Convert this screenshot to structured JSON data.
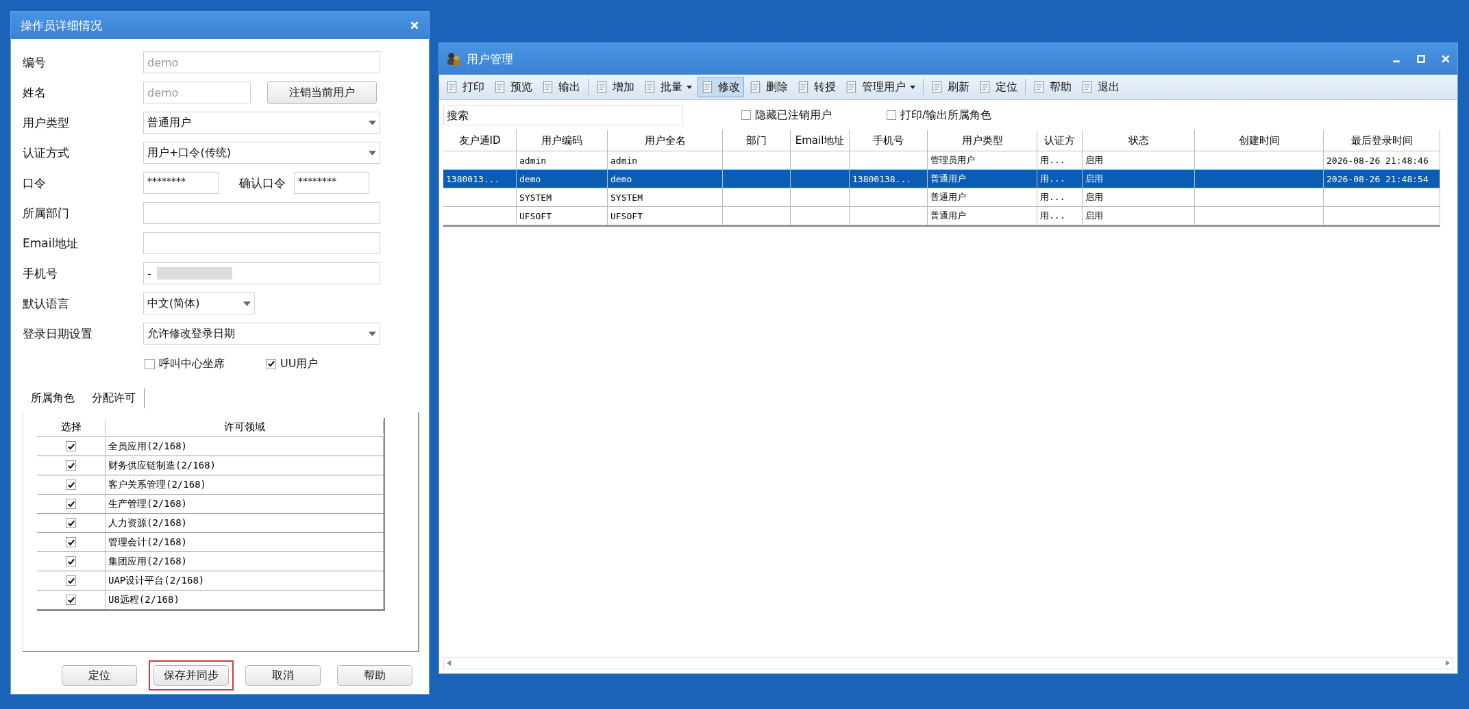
{
  "operator_dialog": {
    "title": "操作员详细情况",
    "fields": [
      {
        "kind": "text",
        "label": "编号",
        "value": "demo",
        "disabled": true
      },
      {
        "kind": "text_button",
        "label": "姓名",
        "value": "demo",
        "disabled": true,
        "button": "注销当前用户"
      },
      {
        "kind": "combo",
        "label": "用户类型",
        "value": "普通用户"
      },
      {
        "kind": "combo",
        "label": "认证方式",
        "value": "用户+口令(传统)"
      },
      {
        "kind": "password",
        "label": "口令",
        "value": "********",
        "confirm_label": "确认口令",
        "confirm_value": "********"
      },
      {
        "kind": "text",
        "label": "所属部门"
      },
      {
        "kind": "text",
        "label": "Email地址"
      },
      {
        "kind": "redacted",
        "label": "手机号",
        "value": "-"
      },
      {
        "kind": "combo_narrow",
        "label": "默认语言",
        "value": "中文(简体)"
      },
      {
        "kind": "combo",
        "label": "登录日期设置",
        "value": "允许修改登录日期"
      }
    ],
    "checkboxes": [
      {
        "label": "呼叫中心坐席",
        "checked": false
      },
      {
        "label": "UU用户",
        "checked": true
      }
    ],
    "tabs": [
      {
        "label": "所属角色",
        "selected": false
      },
      {
        "label": "分配许可",
        "selected": true
      }
    ],
    "license_table": {
      "columns": [
        "选择",
        "许可领域"
      ],
      "rows": [
        {
          "checked": true,
          "domain": "全员应用(2/168)"
        },
        {
          "checked": true,
          "domain": "财务供应链制造(2/168)"
        },
        {
          "checked": true,
          "domain": "客户关系管理(2/168)"
        },
        {
          "checked": true,
          "domain": "生产管理(2/168)"
        },
        {
          "checked": true,
          "domain": "人力资源(2/168)"
        },
        {
          "checked": true,
          "domain": "管理会计(2/168)"
        },
        {
          "checked": true,
          "domain": "集团应用(2/168)"
        },
        {
          "checked": true,
          "domain": "UAP设计平台(2/168)"
        },
        {
          "checked": true,
          "domain": "U8远程(2/168)"
        }
      ]
    },
    "buttons": [
      {
        "label": "定位",
        "highlighted": false
      },
      {
        "label": "保存并同步",
        "highlighted": true
      },
      {
        "label": "取消",
        "highlighted": false
      },
      {
        "label": "帮助",
        "highlighted": false
      }
    ]
  },
  "user_window": {
    "title": "用户管理",
    "toolbar_groups": [
      [
        {
          "label": "打印",
          "dropdown": false,
          "pressed": false
        },
        {
          "label": "预览",
          "dropdown": false,
          "pressed": false
        },
        {
          "label": "输出",
          "dropdown": false,
          "pressed": false
        }
      ],
      [
        {
          "label": "增加",
          "dropdown": false,
          "pressed": false
        },
        {
          "label": "批量",
          "dropdown": true,
          "pressed": false
        },
        {
          "label": "修改",
          "dropdown": false,
          "pressed": true
        },
        {
          "label": "删除",
          "dropdown": false,
          "pressed": false
        },
        {
          "label": "转授",
          "dropdown": false,
          "pressed": false
        },
        {
          "label": "管理用户",
          "dropdown": true,
          "pressed": false
        }
      ],
      [
        {
          "label": "刷新",
          "dropdown": false,
          "pressed": false
        },
        {
          "label": "定位",
          "dropdown": false,
          "pressed": false
        }
      ],
      [
        {
          "label": "帮助",
          "dropdown": false,
          "pressed": false
        },
        {
          "label": "退出",
          "dropdown": false,
          "pressed": false
        }
      ]
    ],
    "search": {
      "placeholder": "搜索"
    },
    "filters": [
      {
        "label": "隐藏已注销用户",
        "checked": false
      },
      {
        "label": "打印/输出所属角色",
        "checked": false
      }
    ],
    "table": {
      "columns": [
        "友户通ID",
        "用户编码",
        "用户全名",
        "部门",
        "Email地址",
        "手机号",
        "用户类型",
        "认证方",
        "状态",
        "创建时间",
        "最后登录时间"
      ],
      "rows": [
        {
          "selected": false,
          "cells": [
            "",
            "admin",
            "admin",
            "",
            "",
            "",
            "管理员用户",
            "用...",
            "启用",
            "",
            "2026-08-26 21:48:46"
          ]
        },
        {
          "selected": true,
          "cells": [
            "1380013...",
            "demo",
            "demo",
            "",
            "",
            "13800138...",
            "普通用户",
            "用...",
            "启用",
            "",
            "2026-08-26 21:48:54"
          ]
        },
        {
          "selected": false,
          "cells": [
            "",
            "SYSTEM",
            "SYSTEM",
            "",
            "",
            "",
            "普通用户",
            "用...",
            "启用",
            "",
            ""
          ]
        },
        {
          "selected": false,
          "cells": [
            "",
            "UFSOFT",
            "UFSOFT",
            "",
            "",
            "",
            "普通用户",
            "用...",
            "启用",
            "",
            ""
          ]
        }
      ]
    }
  }
}
